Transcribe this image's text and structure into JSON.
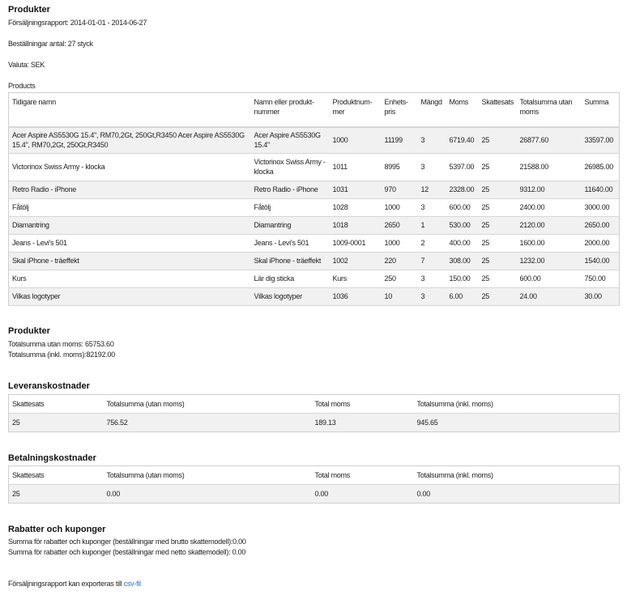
{
  "header": {
    "title": "Produkter",
    "period": "Försäljningsrapport: 2014-01-01 - 2014-06-27",
    "orders": "Beställningar antal: 27 styck",
    "currency": "Valuta: SEK",
    "products_label": "Products"
  },
  "products_table": {
    "columns": [
      "Tidigare namn",
      "Namn eller produkt-nummer",
      "Produktnum-mer",
      "Enhets-pris",
      "Mängd",
      "Moms",
      "Skattesats",
      "Totalsumma utan moms",
      "Summa"
    ],
    "rows": [
      [
        "Acer Aspire AS5530G 15.4\", RM70,2Gt, 250Gt,R3450 Acer Aspire AS5530G 15.4\", RM70,2Gt, 250Gt,R3450",
        "Acer Aspire AS5530G 15.4\"",
        "1000",
        "11199",
        "3",
        "6719.40",
        "25",
        "26877.60",
        "33597.00"
      ],
      [
        "Victorinox Swiss Army - klocka",
        "Victorinox Swiss Army - klocka",
        "1011",
        "8995",
        "3",
        "5397.00",
        "25",
        "21588.00",
        "26985.00"
      ],
      [
        "Retro Radio - iPhone",
        "Retro Radio - iPhone",
        "1031",
        "970",
        "12",
        "2328.00",
        "25",
        "9312.00",
        "11640.00"
      ],
      [
        "Fåtölj",
        "Fåtölj",
        "1028",
        "1000",
        "3",
        "600.00",
        "25",
        "2400.00",
        "3000.00"
      ],
      [
        "Diamantring",
        "Diamantring",
        "1018",
        "2650",
        "1",
        "530.00",
        "25",
        "2120.00",
        "2650.00"
      ],
      [
        "Jeans - Levi's 501",
        "Jeans - Levi's 501",
        "1009-0001",
        "1000",
        "2",
        "400.00",
        "25",
        "1600.00",
        "2000.00"
      ],
      [
        "Skal iPhone - träeffekt",
        "Skal iPhone - träeffekt",
        "1002",
        "220",
        "7",
        "308.00",
        "25",
        "1232.00",
        "1540.00"
      ],
      [
        "Kurs",
        "Lär dig sticka",
        "Kurs",
        "250",
        "3",
        "150.00",
        "25",
        "600.00",
        "750.00"
      ],
      [
        "Vilkas logotyper",
        "Vilkas logotyper",
        "1036",
        "10",
        "3",
        "6.00",
        "25",
        "24.00",
        "30.00"
      ]
    ]
  },
  "products_summary": {
    "title": "Produkter",
    "total_excl": "Totalsumma utan moms:  65753.60",
    "total_incl": "Totalsumma (inkl. moms):82192.00"
  },
  "delivery": {
    "title": "Leveranskostnader",
    "columns": [
      "Skattesats",
      "Totalsumma (utan moms)",
      "Total moms",
      "Totalsumma (inkl. moms)"
    ],
    "row": [
      "25",
      "756.52",
      "189.13",
      "945.65"
    ]
  },
  "payment": {
    "title": "Betalningskostnader",
    "columns": [
      "Skattesats",
      "Totalsumma (utan moms)",
      "Total moms",
      "Totalsumma (inkl. moms)"
    ],
    "row": [
      "25",
      "0.00",
      "0.00",
      "0.00"
    ]
  },
  "discounts": {
    "title": "Rabatter och kuponger",
    "gross": "Summa för rabatter och kuponger (beställningar med brutto skattemodell):0.00",
    "net": "Summa för rabatter och kuponger (beställningar med netto skattemodell): 0.00"
  },
  "export": {
    "text": "Försäljningsrapport kan exporteras till ",
    "link": "csv-fil"
  }
}
